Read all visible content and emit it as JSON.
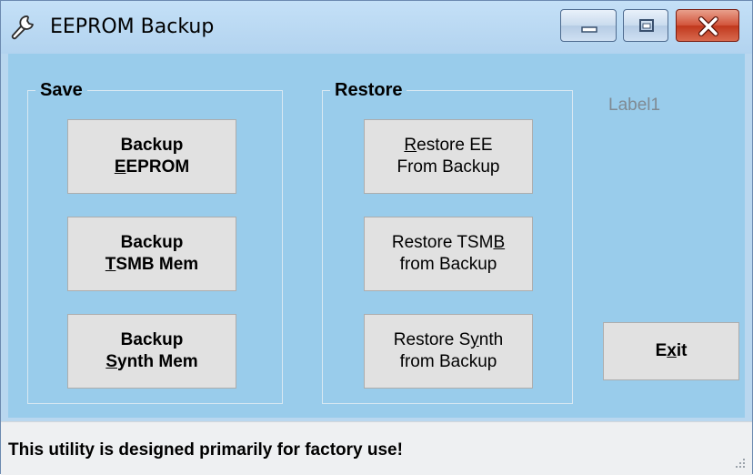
{
  "window": {
    "title": "EEPROM Backup",
    "app_icon": "wrench-icon",
    "controls": {
      "minimize": "minimize-icon",
      "maximize": "maximize-icon",
      "close": "close-icon"
    }
  },
  "save_group": {
    "title": "Save",
    "buttons": [
      {
        "line1": "Backup",
        "line2_mnemonic": "E",
        "line2_rest": "EPROM"
      },
      {
        "line1": "Backup",
        "line2_mnemonic": "T",
        "line2_rest": "SMB Mem"
      },
      {
        "line1": "Backup",
        "line2_mnemonic": "S",
        "line2_rest": "ynth Mem"
      }
    ]
  },
  "restore_group": {
    "title": "Restore",
    "buttons": [
      {
        "line1_mnemonic": "R",
        "line1_rest": "estore EE",
        "line2": "From Backup"
      },
      {
        "line1_pre": "Restore TSM",
        "line1_mnemonic": "B",
        "line2": "from Backup"
      },
      {
        "line1_pre": "Restore S",
        "line1_mnemonic": "y",
        "line1_rest": "nth",
        "line2": "from Backup"
      }
    ]
  },
  "label1": "Label1",
  "exit_button": {
    "pre": "E",
    "mnemonic": "x",
    "rest": "it"
  },
  "status": {
    "text": "This utility is designed primarily for factory use!"
  },
  "colors": {
    "client_bg": "#99cceb",
    "button_bg": "#e1e1e1",
    "status_bg": "#eef0f2",
    "close_red": "#c0381d"
  }
}
